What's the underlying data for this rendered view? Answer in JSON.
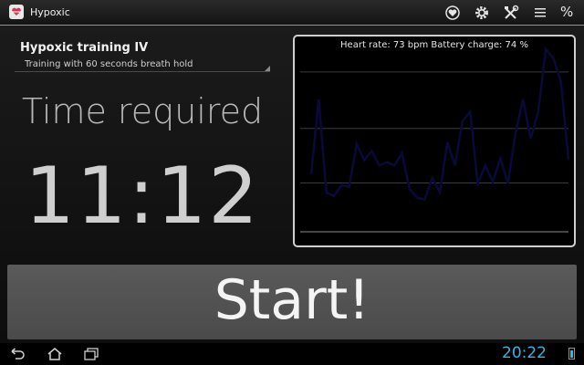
{
  "actionbar": {
    "title": "Hypoxic",
    "icons": [
      "app-heart-icon",
      "heart-circle-icon",
      "gear-icon",
      "tools-icon",
      "list-icon",
      "percent-icon"
    ],
    "percent_glyph": "%"
  },
  "training": {
    "title": "Hypoxic training IV",
    "subtitle": "Training with 60 seconds breath hold"
  },
  "time": {
    "label": "Time required",
    "value": "11:12"
  },
  "chart_caption": "Heart rate: 73 bpm Battery charge: 74 %",
  "chart_data": {
    "type": "line",
    "title": "",
    "xlabel": "",
    "ylabel": "",
    "series": [
      {
        "values": [
          30,
          72,
          20,
          18,
          24,
          23,
          47,
          38,
          43,
          35,
          37,
          35,
          42,
          22,
          17,
          16,
          28,
          20,
          48,
          35,
          60,
          65,
          25,
          35,
          26,
          39,
          25,
          53,
          72,
          50,
          65,
          100,
          95,
          82,
          38
        ]
      }
    ],
    "ylim": [
      0,
      100
    ],
    "grid": true,
    "color": "#0a0a3a"
  },
  "start_button": {
    "label": "Start!"
  },
  "navbar": {
    "icons": [
      "back-icon",
      "home-icon",
      "recent-apps-icon"
    ],
    "clock": "20:22",
    "accent": "#33b5e5"
  }
}
